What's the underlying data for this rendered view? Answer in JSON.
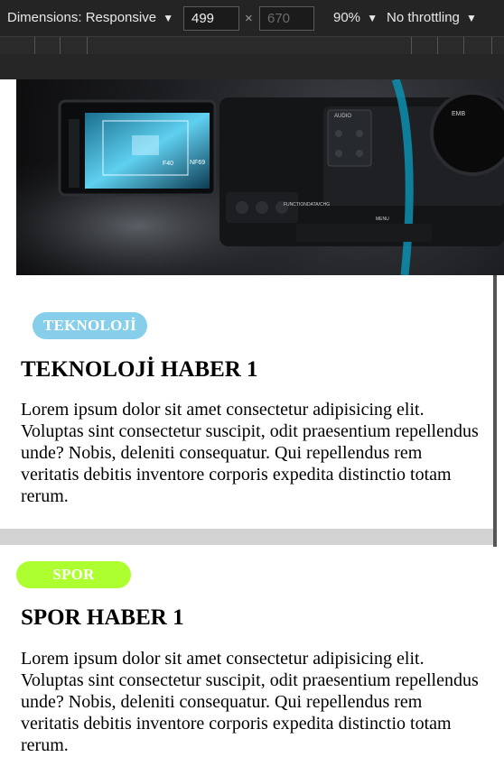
{
  "devtools": {
    "dimensions_label": "Dimensions: Responsive",
    "width_value": "499",
    "height_placeholder": "670",
    "times_symbol": "×",
    "zoom_label": "90%",
    "throttling_label": "No throttling",
    "dropdown_glyph": "▼"
  },
  "hero": {
    "camera_screen_text": "F40",
    "camera_screen_text2": "NF69",
    "camera_audio_label": "AUDIO",
    "camera_brand": "EMB",
    "camera_menu_label": "MENU",
    "camera_function_label": "FUNCTION",
    "camera_iris_label": "DATA/CHG"
  },
  "articles": [
    {
      "category": "TEKNOLOJİ",
      "category_color": "#87ceeb",
      "title": "TEKNOLOJİ HABER 1",
      "body": "Lorem ipsum dolor sit amet consectetur adipisicing elit. Voluptas sint consectetur suscipit, odit praesentium repellendus unde? Nobis, deleniti consequatur. Qui repellendus rem veritatis debitis inventore corporis expedita distinctio totam rerum."
    },
    {
      "category": "SPOR",
      "category_color": "#adff2f",
      "title": "SPOR HABER 1",
      "body": "Lorem ipsum dolor sit amet consectetur adipisicing elit. Voluptas sint consectetur suscipit, odit praesentium repellendus unde? Nobis, deleniti consequatur. Qui repellendus rem veritatis debitis inventore corporis expedita distinctio totam rerum."
    }
  ]
}
